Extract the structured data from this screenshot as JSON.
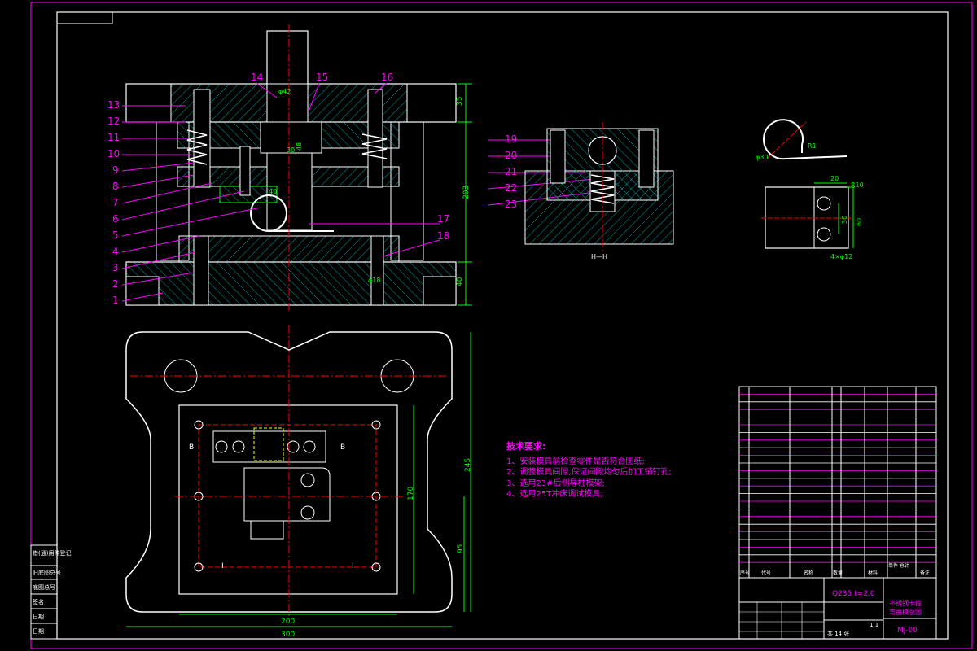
{
  "colors": {
    "background": "#000000",
    "outline": "#ffffff",
    "hatch": "#00a0a0",
    "leader": "#ff00ff",
    "dimension": "#00ff00",
    "center": "#ff0000",
    "hidden": "#ffff00",
    "notes": "#ff00ff"
  },
  "section_view": {
    "part_numbers_left": [
      "13",
      "12",
      "11",
      "10",
      "9",
      "8",
      "7",
      "6",
      "5",
      "4",
      "3",
      "2",
      "1"
    ],
    "part_numbers_top": [
      "14",
      "15",
      "16"
    ],
    "part_numbers_right": [
      "17",
      "18"
    ],
    "dim_total_height": "203",
    "dim_top_plate": "35",
    "dim_bottom_plate": "40",
    "dim_punch_dia": "φ42",
    "dim_punch_height": "48",
    "dim_punch_width": "30",
    "dim_die": "40",
    "dim_guide": "φ18"
  },
  "detail_view": {
    "part_numbers": [
      "19",
      "20",
      "21",
      "22",
      "23"
    ],
    "section_label": "H—H"
  },
  "plan_view": {
    "dim_width_outer": "300",
    "dim_width_inner": "200",
    "dim_height_outer": "245",
    "dim_height_inner": "170",
    "dim_lower": "95",
    "section_mark_left": "B",
    "section_mark_right": "B",
    "marker_left": "I",
    "marker_right": "I"
  },
  "part_view": {
    "dim_radius": "φ30",
    "dim_r": "R1",
    "dim_20": "20",
    "dim_r10": "R10",
    "dim_30": "30",
    "dim_60": "60",
    "dim_holes": "4×φ12"
  },
  "notes": {
    "title": "技术要求:",
    "lines": [
      "1、安装模具前检查零件是否符合图纸;",
      "2、调整模具间隙,保证间隙均匀后加工销钉孔;",
      "3、选用23#后侧导柱模架;",
      "4、选用25T冲床调试模具;"
    ]
  },
  "title_block": {
    "material": "Q235 t=2.0",
    "name_line1": "不锈钢卡箍",
    "name_line2": "弯曲模总图",
    "drawing_no": "MJ-00",
    "scale": "1:1",
    "sheet": "共 14 张",
    "header_seq": "序号",
    "header_code": "代号",
    "header_name": "名称",
    "header_qty": "数量",
    "header_material": "材料",
    "header_weight": "单件 总计",
    "header_note": "备注"
  },
  "side_labels": [
    "借(通)用件登记",
    "旧底图总号",
    "底图总号",
    "签名",
    "日期",
    "日期"
  ]
}
